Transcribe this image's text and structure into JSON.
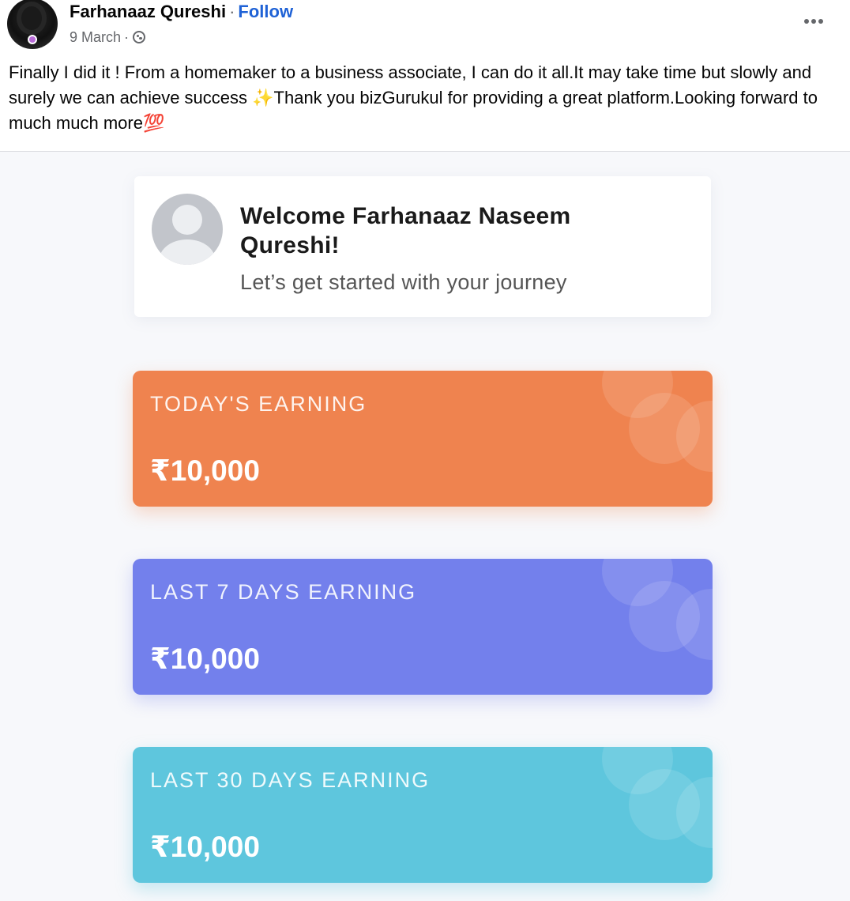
{
  "post": {
    "author_name": "Farhanaaz Qureshi",
    "separator": "·",
    "follow_label": "Follow",
    "date": "9 March",
    "date_separator": "·",
    "audience_icon": "globe-icon",
    "more_icon": "more-options-icon",
    "text": "Finally I did it ! From a homemaker to a business associate, I can do it all.It may take time but slowly and surely we can achieve success ✨Thank you bizGurukul for providing a great platform.Looking forward to much much more💯"
  },
  "dashboard": {
    "welcome_title": "Welcome Farhanaaz Naseem Qureshi!",
    "welcome_subtitle": "Let’s get started with your journey",
    "cards": [
      {
        "label": "TODAY'S EARNING",
        "amount": "₹10,000",
        "color": "#ef834f"
      },
      {
        "label": "LAST 7 DAYS EARNING",
        "amount": "₹10,000",
        "color": "#7380ec"
      },
      {
        "label": "LAST 30 DAYS EARNING",
        "amount": "₹10,000",
        "color": "#5ec6dd"
      }
    ]
  }
}
